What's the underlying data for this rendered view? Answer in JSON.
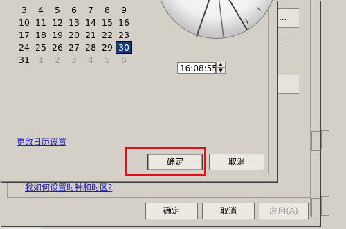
{
  "calendar": {
    "rows": [
      [
        {
          "d": "3"
        },
        {
          "d": "4"
        },
        {
          "d": "5"
        },
        {
          "d": "6"
        },
        {
          "d": "7"
        },
        {
          "d": "8"
        },
        {
          "d": "9"
        }
      ],
      [
        {
          "d": "10"
        },
        {
          "d": "11"
        },
        {
          "d": "12"
        },
        {
          "d": "13"
        },
        {
          "d": "14"
        },
        {
          "d": "15"
        },
        {
          "d": "16"
        }
      ],
      [
        {
          "d": "17"
        },
        {
          "d": "18"
        },
        {
          "d": "19"
        },
        {
          "d": "20"
        },
        {
          "d": "21"
        },
        {
          "d": "22"
        },
        {
          "d": "23"
        }
      ],
      [
        {
          "d": "24"
        },
        {
          "d": "25"
        },
        {
          "d": "26"
        },
        {
          "d": "27"
        },
        {
          "d": "28"
        },
        {
          "d": "29"
        },
        {
          "d": "30",
          "selected": true
        }
      ],
      [
        {
          "d": "31"
        },
        {
          "d": "1",
          "dim": true
        },
        {
          "d": "2",
          "dim": true
        },
        {
          "d": "3",
          "dim": true
        },
        {
          "d": "4",
          "dim": true
        },
        {
          "d": "5",
          "dim": true
        },
        {
          "d": "6",
          "dim": true
        }
      ]
    ]
  },
  "time": {
    "value": "16:08:55"
  },
  "main_dialog": {
    "change_calendar_link": "更改日历设置",
    "ok_label": "确定",
    "cancel_label": "取消"
  },
  "back_dialog": {
    "timezone_link": "我如何设置时钟和时区?",
    "ok_label": "确定",
    "cancel_label": "取消",
    "apply_label": "应用(A)",
    "partial_button_label": "..."
  },
  "colors": {
    "highlight": "#e0101a",
    "selected_day": "#173b7a"
  }
}
